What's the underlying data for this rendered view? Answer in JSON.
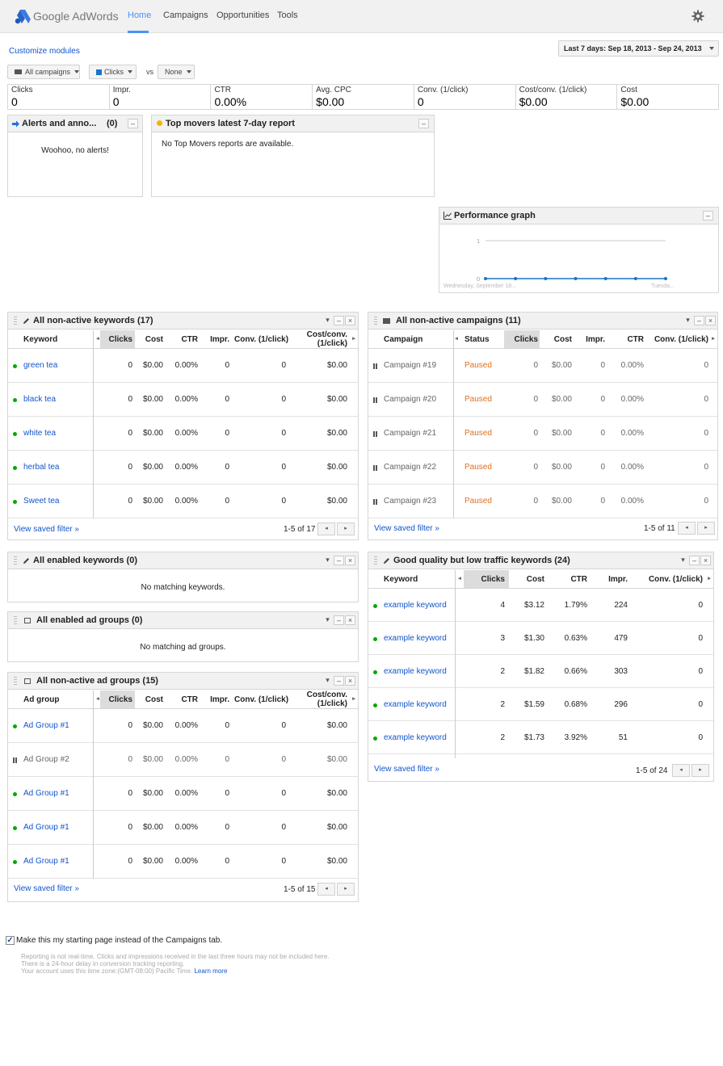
{
  "header": {
    "logo_text": "Google AdWords",
    "nav": [
      "Home",
      "Campaigns",
      "Opportunities",
      "Tools"
    ]
  },
  "toolbar": {
    "customize": "Customize modules",
    "date_range": "Last 7 days: Sep 18, 2013 - Sep 24, 2013",
    "campaigns_filter": "All campaigns",
    "metric1": "Clicks",
    "vs": "vs",
    "metric2": "None"
  },
  "stats": [
    {
      "label": "Clicks",
      "value": "0"
    },
    {
      "label": "Impr.",
      "value": "0"
    },
    {
      "label": "CTR",
      "value": "0.00%"
    },
    {
      "label": "Avg. CPC",
      "value": "$0.00"
    },
    {
      "label": "Conv. (1/click)",
      "value": "0"
    },
    {
      "label": "Cost/conv. (1/click)",
      "value": "$0.00"
    },
    {
      "label": "Cost",
      "value": "$0.00"
    }
  ],
  "alerts": {
    "title": "Alerts and anno...",
    "count": "(0)",
    "message": "Woohoo, no alerts!"
  },
  "movers": {
    "title": "Top movers latest 7-day report",
    "message": "No Top Movers reports are available."
  },
  "perf": {
    "title": "Performance graph",
    "y_top": "1",
    "y_bottom": "0",
    "x_start": "Wednesday, September 18...",
    "x_end": "Tuesda..."
  },
  "chart_data": {
    "type": "line",
    "x": [
      "Sep 18",
      "Sep 19",
      "Sep 20",
      "Sep 21",
      "Sep 22",
      "Sep 23",
      "Sep 24"
    ],
    "series": [
      {
        "values": [
          0,
          0,
          0,
          0,
          0,
          0,
          0
        ]
      }
    ],
    "ylim": [
      0,
      1
    ],
    "grid": true
  },
  "kw_inactive": {
    "title": "All non-active keywords (17)",
    "headers": [
      "Keyword",
      "Clicks",
      "Cost",
      "CTR",
      "Impr.",
      "Conv. (1/click)",
      "Cost/conv.",
      "(1/click)"
    ],
    "rows": [
      {
        "name": "green tea",
        "clicks": "0",
        "cost": "$0.00",
        "ctr": "0.00%",
        "impr": "0",
        "conv": "0",
        "cpc": "$0.00"
      },
      {
        "name": "black tea",
        "clicks": "0",
        "cost": "$0.00",
        "ctr": "0.00%",
        "impr": "0",
        "conv": "0",
        "cpc": "$0.00"
      },
      {
        "name": "white tea",
        "clicks": "0",
        "cost": "$0.00",
        "ctr": "0.00%",
        "impr": "0",
        "conv": "0",
        "cpc": "$0.00"
      },
      {
        "name": "herbal tea",
        "clicks": "0",
        "cost": "$0.00",
        "ctr": "0.00%",
        "impr": "0",
        "conv": "0",
        "cpc": "$0.00"
      },
      {
        "name": "Sweet tea",
        "clicks": "0",
        "cost": "$0.00",
        "ctr": "0.00%",
        "impr": "0",
        "conv": "0",
        "cpc": "$0.00"
      }
    ],
    "saved": "View saved filter »",
    "pager": "1-5 of 17"
  },
  "camp_inactive": {
    "title": "All non-active campaigns (11)",
    "headers": [
      "Campaign",
      "Status",
      "Clicks",
      "Cost",
      "Impr.",
      "CTR",
      "Conv. (1/click)"
    ],
    "rows": [
      {
        "name": "Campaign #19",
        "status": "Paused",
        "clicks": "0",
        "cost": "$0.00",
        "impr": "0",
        "ctr": "0.00%",
        "conv": "0"
      },
      {
        "name": "Campaign #20",
        "status": "Paused",
        "clicks": "0",
        "cost": "$0.00",
        "impr": "0",
        "ctr": "0.00%",
        "conv": "0"
      },
      {
        "name": "Campaign #21",
        "status": "Paused",
        "clicks": "0",
        "cost": "$0.00",
        "impr": "0",
        "ctr": "0.00%",
        "conv": "0"
      },
      {
        "name": "Campaign #22",
        "status": "Paused",
        "clicks": "0",
        "cost": "$0.00",
        "impr": "0",
        "ctr": "0.00%",
        "conv": "0"
      },
      {
        "name": "Campaign #23",
        "status": "Paused",
        "clicks": "0",
        "cost": "$0.00",
        "impr": "0",
        "ctr": "0.00%",
        "conv": "0"
      }
    ],
    "saved": "View saved filter »",
    "pager": "1-5 of 11"
  },
  "kw_enabled": {
    "title": "All enabled keywords (0)",
    "message": "No matching keywords."
  },
  "ag_enabled": {
    "title": "All enabled ad groups (0)",
    "message": "No matching ad groups."
  },
  "ag_inactive": {
    "title": "All non-active ad groups (15)",
    "headers": [
      "Ad group",
      "Clicks",
      "Cost",
      "CTR",
      "Impr.",
      "Conv. (1/click)",
      "Cost/conv.",
      "(1/click)"
    ],
    "rows": [
      {
        "name": "Ad Group #1",
        "clicks": "0",
        "cost": "$0.00",
        "ctr": "0.00%",
        "impr": "0",
        "conv": "0",
        "cpc": "$0.00"
      },
      {
        "name": "Ad Group #2",
        "clicks": "0",
        "cost": "$0.00",
        "ctr": "0.00%",
        "impr": "0",
        "conv": "0",
        "cpc": "$0.00"
      },
      {
        "name": "Ad Group #1",
        "clicks": "0",
        "cost": "$0.00",
        "ctr": "0.00%",
        "impr": "0",
        "conv": "0",
        "cpc": "$0.00"
      },
      {
        "name": "Ad Group #1",
        "clicks": "0",
        "cost": "$0.00",
        "ctr": "0.00%",
        "impr": "0",
        "conv": "0",
        "cpc": "$0.00"
      },
      {
        "name": "Ad Group #1",
        "clicks": "0",
        "cost": "$0.00",
        "ctr": "0.00%",
        "impr": "0",
        "conv": "0",
        "cpc": "$0.00"
      }
    ],
    "saved": "View saved filter »",
    "pager": "1-5 of 15"
  },
  "kw_quality": {
    "title": "Good quality but low traffic keywords (24)",
    "headers": [
      "Keyword",
      "Clicks",
      "Cost",
      "CTR",
      "Impr.",
      "Conv. (1/click)"
    ],
    "rows": [
      {
        "name": "example keyword",
        "clicks": "4",
        "cost": "$3.12",
        "ctr": "1.79%",
        "impr": "224",
        "conv": "0"
      },
      {
        "name": "example keyword",
        "clicks": "3",
        "cost": "$1.30",
        "ctr": "0.63%",
        "impr": "479",
        "conv": "0"
      },
      {
        "name": "example keyword",
        "clicks": "2",
        "cost": "$1.82",
        "ctr": "0.66%",
        "impr": "303",
        "conv": "0"
      },
      {
        "name": "example keyword",
        "clicks": "2",
        "cost": "$1.59",
        "ctr": "0.68%",
        "impr": "296",
        "conv": "0"
      },
      {
        "name": "example keyword",
        "clicks": "2",
        "cost": "$1.73",
        "ctr": "3.92%",
        "impr": "51",
        "conv": "0"
      }
    ],
    "saved": "View saved filter »",
    "pager": "1-5 of 24"
  },
  "footer": {
    "checkbox_label": "Make this my starting page instead of the Campaigns tab.",
    "note1": "Reporting is not real-time. Clicks and impressions received in the last three hours may not be included here.",
    "note2": "There is a 24-hour delay in conversion tracking reporting.",
    "note3": "Your account uses this time zone:(GMT-08:00) Pacific Time.",
    "learn_more": "Learn more"
  }
}
